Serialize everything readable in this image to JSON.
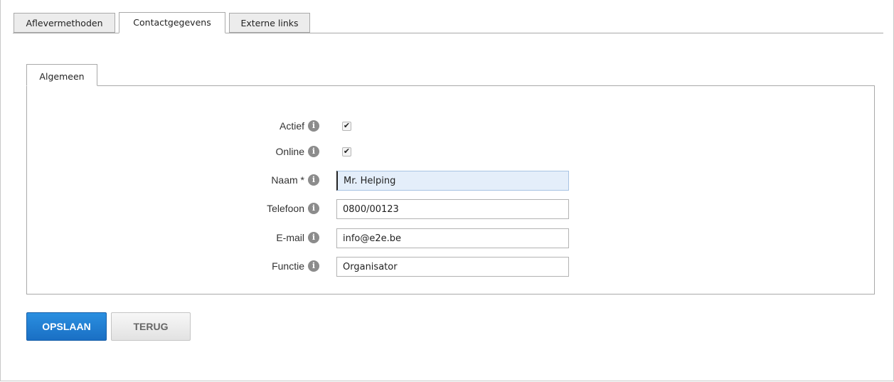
{
  "tabs": [
    "Aflevermethoden",
    "Contactgegevens",
    "Externe links"
  ],
  "active_tab": "Contactgegevens",
  "subtab": {
    "label": "Algemeen"
  },
  "form": {
    "actief": {
      "label": "Actief",
      "checked": true
    },
    "online": {
      "label": "Online",
      "checked": true
    },
    "naam": {
      "label": "Naam *",
      "value": "Mr. Helping"
    },
    "telefoon": {
      "label": "Telefoon",
      "value": "0800/00123"
    },
    "email": {
      "label": "E-mail",
      "value": "info@e2e.be"
    },
    "functie": {
      "label": "Functie",
      "value": "Organisator"
    }
  },
  "info_glyph": "i",
  "check_glyph": "✔",
  "buttons": {
    "save": "OPSLAAN",
    "back": "TERUG"
  },
  "colors": {
    "primary": "#1a6fc4",
    "focus_bg": "#e4eefa"
  }
}
